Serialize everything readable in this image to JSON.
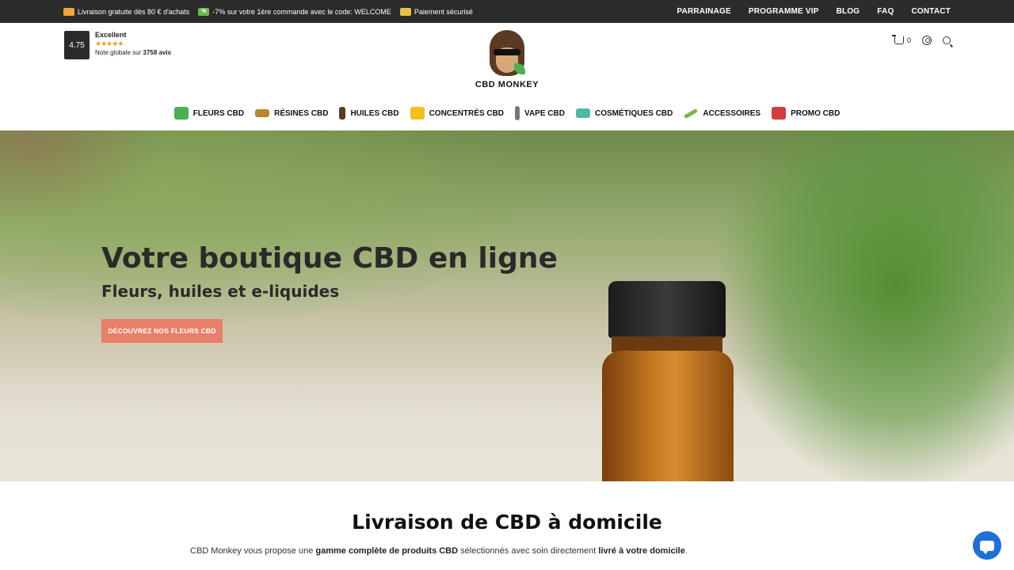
{
  "topbar": {
    "promos": [
      {
        "icon": "truck-icon",
        "text": "Livraison gratuite dès 80 € d'achats"
      },
      {
        "icon": "percent-icon",
        "text": "-7% sur votre 1ère commande avec le code: WELCOME",
        "badge": "%"
      },
      {
        "icon": "card-icon",
        "text": "Paiement sécurisé"
      }
    ],
    "links": [
      "PARRAINAGE",
      "PROGRAMME VIP",
      "BLOG",
      "FAQ",
      "CONTACT"
    ]
  },
  "rating": {
    "score": "4.75",
    "label": "Excellent",
    "stars": "★★★★★",
    "total_prefix": "Note globale sur",
    "total_count": "3758 avis"
  },
  "logo": {
    "brand": "CBD MONKEY"
  },
  "header_icons": {
    "cart_count": "0"
  },
  "menu": [
    {
      "label": "FLEURS CBD",
      "icon": "leaf-icon",
      "cls": "leaf"
    },
    {
      "label": "RÉSINES CBD",
      "icon": "resin-icon",
      "cls": "resin"
    },
    {
      "label": "HUILES CBD",
      "icon": "oil-bottle-icon",
      "cls": "oil"
    },
    {
      "label": "CONCENTRÉS CBD",
      "icon": "concentrate-icon",
      "cls": "conc"
    },
    {
      "label": "VAPE CBD",
      "icon": "vape-icon",
      "cls": "vape"
    },
    {
      "label": "COSMÉTIQUES CBD",
      "icon": "cosmetics-icon",
      "cls": "cosm"
    },
    {
      "label": "ACCESSOIRES",
      "icon": "accessories-icon",
      "cls": "acc"
    },
    {
      "label": "PROMO CBD",
      "icon": "promo-icon",
      "cls": "promo"
    }
  ],
  "hero": {
    "title": "Votre boutique CBD en ligne",
    "subtitle": "Fleurs, huiles et e-liquides",
    "button": "DÉCOUVREZ NOS FLEURS CBD"
  },
  "section": {
    "title": "Livraison de CBD à domicile",
    "text_1": "CBD Monkey vous propose une ",
    "text_2": "gamme complète de produits CBD",
    "text_3": " sélectionnés avec soin directement ",
    "text_4": "livré à votre domicile",
    "text_5": "."
  },
  "colors": {
    "accent": "#e87f6a",
    "topbar": "#2b2b2b",
    "chat": "#1e6fd6"
  }
}
